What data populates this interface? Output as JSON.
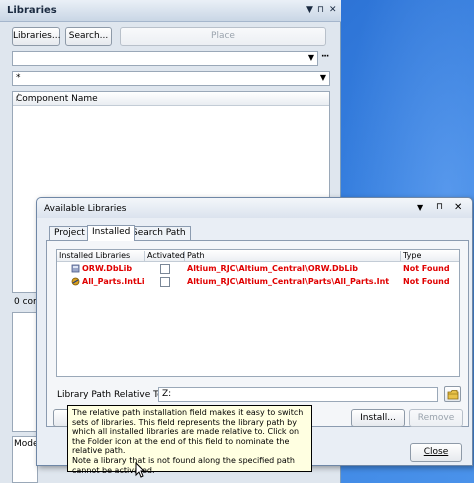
{
  "libraries_panel": {
    "title": "Libraries",
    "buttons": {
      "libraries": "Libraries...",
      "search": "Search...",
      "place": "Place"
    },
    "filter_value": "*",
    "more_glyph": "···",
    "component_header": "Component Name",
    "component_header_sep": "/",
    "count_label": "0 com",
    "model_label": "Mode"
  },
  "dialog": {
    "title": "Available Libraries",
    "tabs": [
      {
        "label": "Project"
      },
      {
        "label": "Installed"
      },
      {
        "label": "Search Path"
      }
    ],
    "columns": [
      "Installed Libraries",
      "Activated",
      "Path",
      "Type"
    ],
    "rows": [
      {
        "name": "ORW.DbLib",
        "path": "Altium_RJC\\Altium_Central\\ORW.DbLib",
        "type": "Not Found"
      },
      {
        "name": "All_Parts.IntLib",
        "path": "Altium_RJC\\Altium_Central\\Parts\\All_Parts.Int",
        "type": "Not Found"
      }
    ],
    "path_label": "Library Path Relative To:",
    "path_value": "Z:",
    "buttons": {
      "install": "Install...",
      "remove": "Remove",
      "close": "Close"
    },
    "tooltip": "The relative path installation field makes it easy to switch sets of libraries. This field represents the library path by which all installed libraries are made relative to. Click on the Folder icon at the end of this field to nominate the relative path.\nNote a library that is not found along the specified path cannot be activated."
  },
  "colors": {
    "not_found": "#e00000",
    "desktop": "#2f76d8",
    "tooltip_bg": "#ffffe1"
  },
  "icons": [
    "pin-icon",
    "close-icon",
    "chevron-down-icon",
    "database-icon",
    "integrated-library-icon",
    "folder-icon"
  ]
}
